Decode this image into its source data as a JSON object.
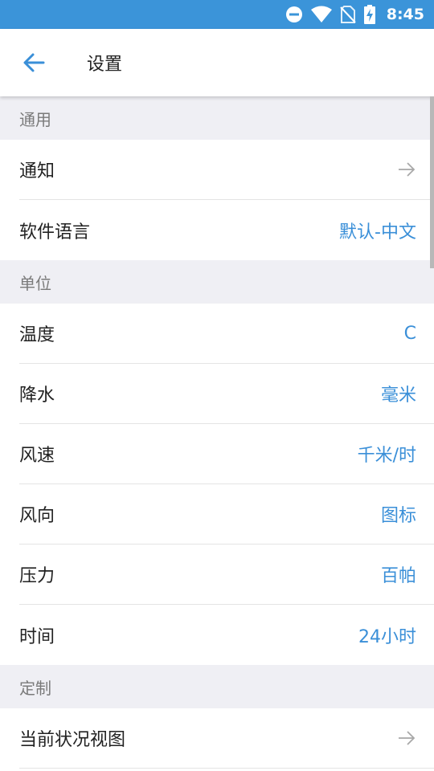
{
  "status_bar": {
    "time": "8:45"
  },
  "app_bar": {
    "title": "设置"
  },
  "sections": {
    "general": {
      "header": "通用",
      "notifications": {
        "label": "通知"
      },
      "language": {
        "label": "软件语言",
        "value": "默认-中文"
      }
    },
    "units": {
      "header": "单位",
      "temperature": {
        "label": "温度",
        "value": "C"
      },
      "precipitation": {
        "label": "降水",
        "value": "毫米"
      },
      "wind_speed": {
        "label": "风速",
        "value": "千米/时"
      },
      "wind_direction": {
        "label": "风向",
        "value": "图标"
      },
      "pressure": {
        "label": "压力",
        "value": "百帕"
      },
      "time": {
        "label": "时间",
        "value": "24小时"
      }
    },
    "custom": {
      "header": "定制",
      "current_view": {
        "label": "当前状况视图"
      }
    }
  },
  "colors": {
    "status_bar": "#3b94d9",
    "accent": "#3a8fd8",
    "section_bg": "#efeff4"
  }
}
